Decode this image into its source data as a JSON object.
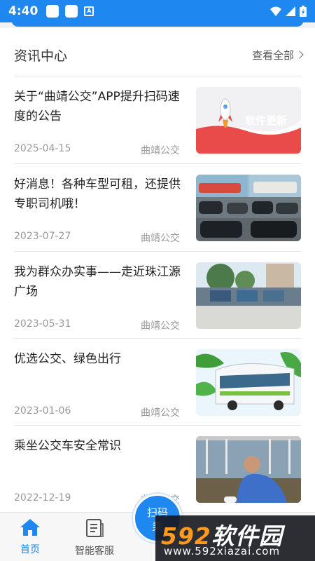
{
  "status_bar": {
    "time": "4:40",
    "a_glyph": "A"
  },
  "section": {
    "title": "资讯中心",
    "view_all": "查看全部"
  },
  "news": [
    {
      "title": "关于“曲靖公交”APP提升扫码速度的公告",
      "date": "2025-04-15",
      "source": "曲靖公交",
      "thumb_text": "软件更新"
    },
    {
      "title": "好消息！各种车型可租，还提供专职司机哦！",
      "date": "2023-07-27",
      "source": "曲靖公交"
    },
    {
      "title": "我为群众办实事——走近珠江源广场",
      "date": "2023-05-31",
      "source": "曲靖公交"
    },
    {
      "title": "优选公交、绿色出行",
      "date": "2023-01-06",
      "source": "曲靖公交"
    },
    {
      "title": "乘坐公交车安全常识",
      "date": "2022-12-19",
      "source": "曲靖公交"
    }
  ],
  "nav": {
    "home": "首页",
    "service": "智能客服",
    "scan_line1": "扫码",
    "scan_line2": "乘"
  },
  "watermark": {
    "num": "592",
    "name": "软件园",
    "url": "www.592xiazai.com"
  },
  "colors": {
    "accent": "#1e88f0",
    "text": "#222222",
    "muted": "#999999"
  }
}
